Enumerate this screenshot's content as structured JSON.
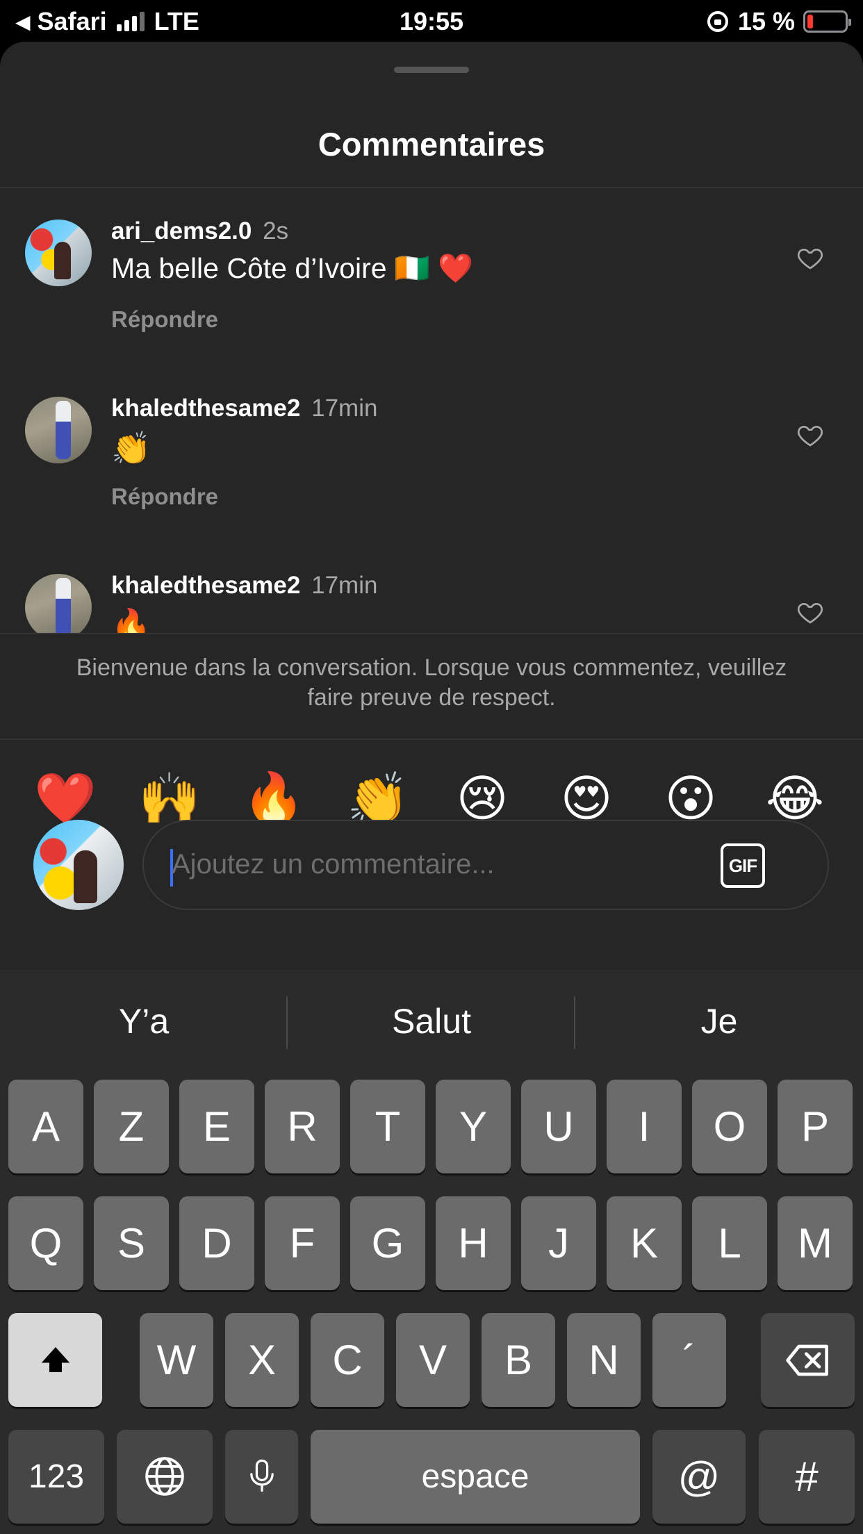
{
  "status_bar": {
    "back_arrow": "◀",
    "carrier": "Safari",
    "network": "LTE",
    "time": "19:55",
    "battery": "15 %",
    "battery_level": 0.15,
    "battery_color": "#ff3b30"
  },
  "sheet": {
    "title": "Commentaires"
  },
  "comments": [
    {
      "username": "ari_dems2.0",
      "time": "2s",
      "text": "Ma belle Côte d’Ivoire 🇨🇮 ❤️",
      "reply_label": "Répondre"
    },
    {
      "username": "khaledthesame2",
      "time": "17min",
      "text": "👏",
      "reply_label": "Répondre"
    },
    {
      "username": "khaledthesame2",
      "time": "17min",
      "text": "🔥"
    }
  ],
  "welcome_message": "Bienvenue dans la conversation. Lorsque vous commentez, veuillez faire preuve de respect.",
  "reactions": [
    "❤️",
    "🙌",
    "🔥",
    "👏",
    "😢",
    "😍",
    "😮",
    "😂"
  ],
  "comment_input": {
    "placeholder": "Ajoutez un commentaire...",
    "gif_label": "GIF"
  },
  "keyboard": {
    "suggestions": [
      "Y’a",
      "Salut",
      "Je"
    ],
    "row1": [
      "A",
      "Z",
      "E",
      "R",
      "T",
      "Y",
      "U",
      "I",
      "O",
      "P"
    ],
    "row2": [
      "Q",
      "S",
      "D",
      "F",
      "G",
      "H",
      "J",
      "K",
      "L",
      "M"
    ],
    "row3": [
      "W",
      "X",
      "C",
      "V",
      "B",
      "N",
      "´"
    ],
    "numbers_label": "123",
    "space_label": "espace",
    "at_label": "@",
    "hash_label": "#"
  }
}
